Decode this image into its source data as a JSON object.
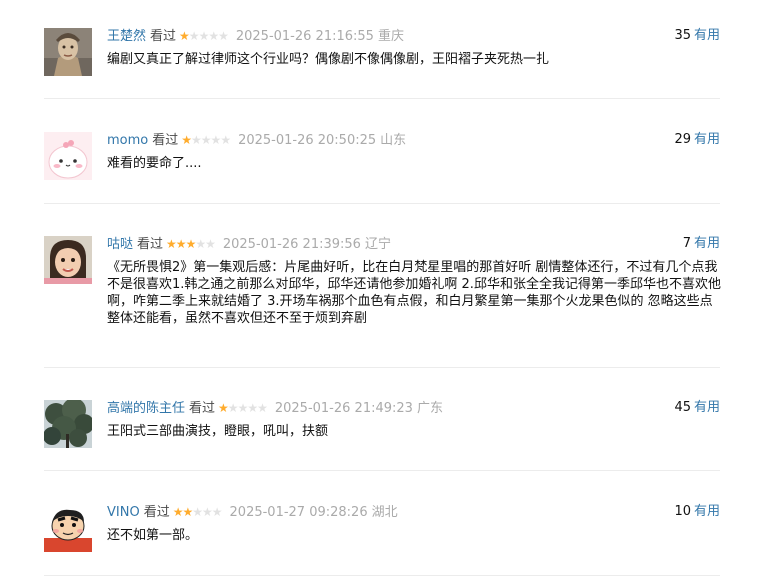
{
  "comments": [
    {
      "user": "王楚然",
      "status": "看过",
      "rating": 1,
      "time": "2025-01-26 21:16:55",
      "location": "重庆",
      "votes": "35",
      "useful_label": "有用",
      "text": "编剧又真正了解过律师这个行业吗？偶像剧不像偶像剧，王阳褶子夹死热一扎",
      "avatar_icon": "statue-avatar-icon"
    },
    {
      "user": "momo",
      "status": "看过",
      "rating": 1,
      "time": "2025-01-26 20:50:25",
      "location": "山东",
      "votes": "29",
      "useful_label": "有用",
      "text": "难看的要命了....",
      "avatar_icon": "pink-cartoon-avatar-icon"
    },
    {
      "user": "咕哒",
      "status": "看过",
      "rating": 3,
      "time": "2025-01-26 21:39:56",
      "location": "辽宁",
      "votes": "7",
      "useful_label": "有用",
      "text": "《无所畏惧2》第一集观后感：片尾曲好听，比在白月梵星里唱的那首好听 剧情整体还行，不过有几个点我不是很喜欢1.韩之通之前那么对邱华，邱华还请他参加婚礼啊 2.邱华和张全全我记得第一季邱华也不喜欢他啊，咋第二季上来就结婚了 3.开场车祸那个血色有点假，和白月繁星第一集那个火龙果色似的 忽略这些点整体还能看，虽然不喜欢但还不至于烦到弃剧",
      "avatar_icon": "child-photo-avatar-icon"
    },
    {
      "user": "高端的陈主任",
      "status": "看过",
      "rating": 1,
      "time": "2025-01-26 21:49:23",
      "location": "广东",
      "votes": "45",
      "useful_label": "有用",
      "text": "王阳式三部曲演技，瞪眼，吼叫，扶额",
      "avatar_icon": "tree-photo-avatar-icon"
    },
    {
      "user": "VINO",
      "status": "看过",
      "rating": 2,
      "time": "2025-01-27 09:28:26",
      "location": "湖北",
      "votes": "10",
      "useful_label": "有用",
      "text": "还不如第一部。",
      "avatar_icon": "crayon-shin-chan-avatar-icon"
    }
  ],
  "colors": {
    "link": "#3377aa",
    "star_on": "#ffac2d",
    "star_off": "#e2e2e2",
    "meta": "#aaaaaa",
    "divider": "#ececec"
  }
}
